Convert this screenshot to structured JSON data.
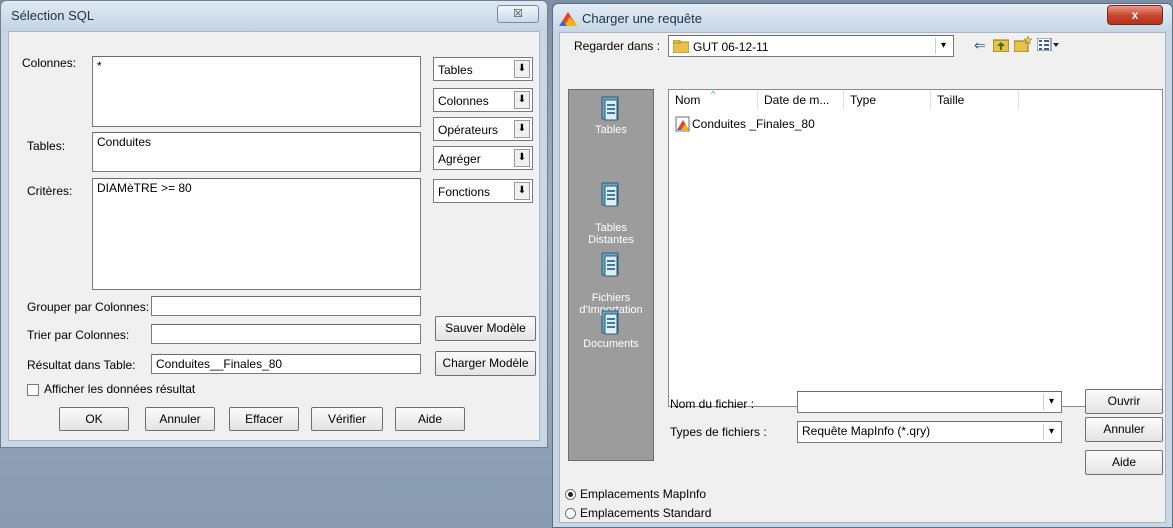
{
  "sql_dialog": {
    "title": "Sélection SQL",
    "close_label": "☒",
    "labels": {
      "colonnes": "Colonnes:",
      "tables": "Tables:",
      "criteres": "Critères:",
      "grouper": "Grouper par Colonnes:",
      "trier": "Trier par Colonnes:",
      "resultat": "Résultat dans Table:",
      "afficher": "Afficher les données résultat"
    },
    "values": {
      "colonnes": "*",
      "tables": "Conduites",
      "criteres": "DIAMèTRE >= 80",
      "grouper": "",
      "trier": "",
      "resultat": "Conduites__Finales_80"
    },
    "dropdowns": [
      "Tables",
      "Colonnes",
      "Opérateurs",
      "Agréger",
      "Fonctions"
    ],
    "side_buttons": {
      "save": "Sauver Modèle",
      "load": "Charger Modèle"
    },
    "buttons": {
      "ok": "OK",
      "cancel": "Annuler",
      "clear": "Effacer",
      "verify": "Vérifier",
      "help": "Aide"
    },
    "afficher_checked": false
  },
  "open_dialog": {
    "title": "Charger une requête",
    "close_label": "x",
    "look_in_label": "Regarder dans :",
    "look_in_value": "GUT 06-12-11",
    "places": [
      "Tables",
      "Tables\nDistantes",
      "Fichiers\nd'Importation",
      "Documents"
    ],
    "columns": [
      "Nom",
      "Date de m...",
      "Type",
      "Taille"
    ],
    "files": [
      "Conduites _Finales_80"
    ],
    "filename_label": "Nom du fichier :",
    "filename_value": "",
    "filetype_label": "Types de fichiers :",
    "filetype_value": "Requête MapInfo (*.qry)",
    "buttons": {
      "open": "Ouvrir",
      "cancel": "Annuler",
      "help": "Aide"
    },
    "radios": [
      {
        "label": "Emplacements MapInfo",
        "checked": true
      },
      {
        "label": "Emplacements Standard",
        "checked": false
      }
    ]
  }
}
